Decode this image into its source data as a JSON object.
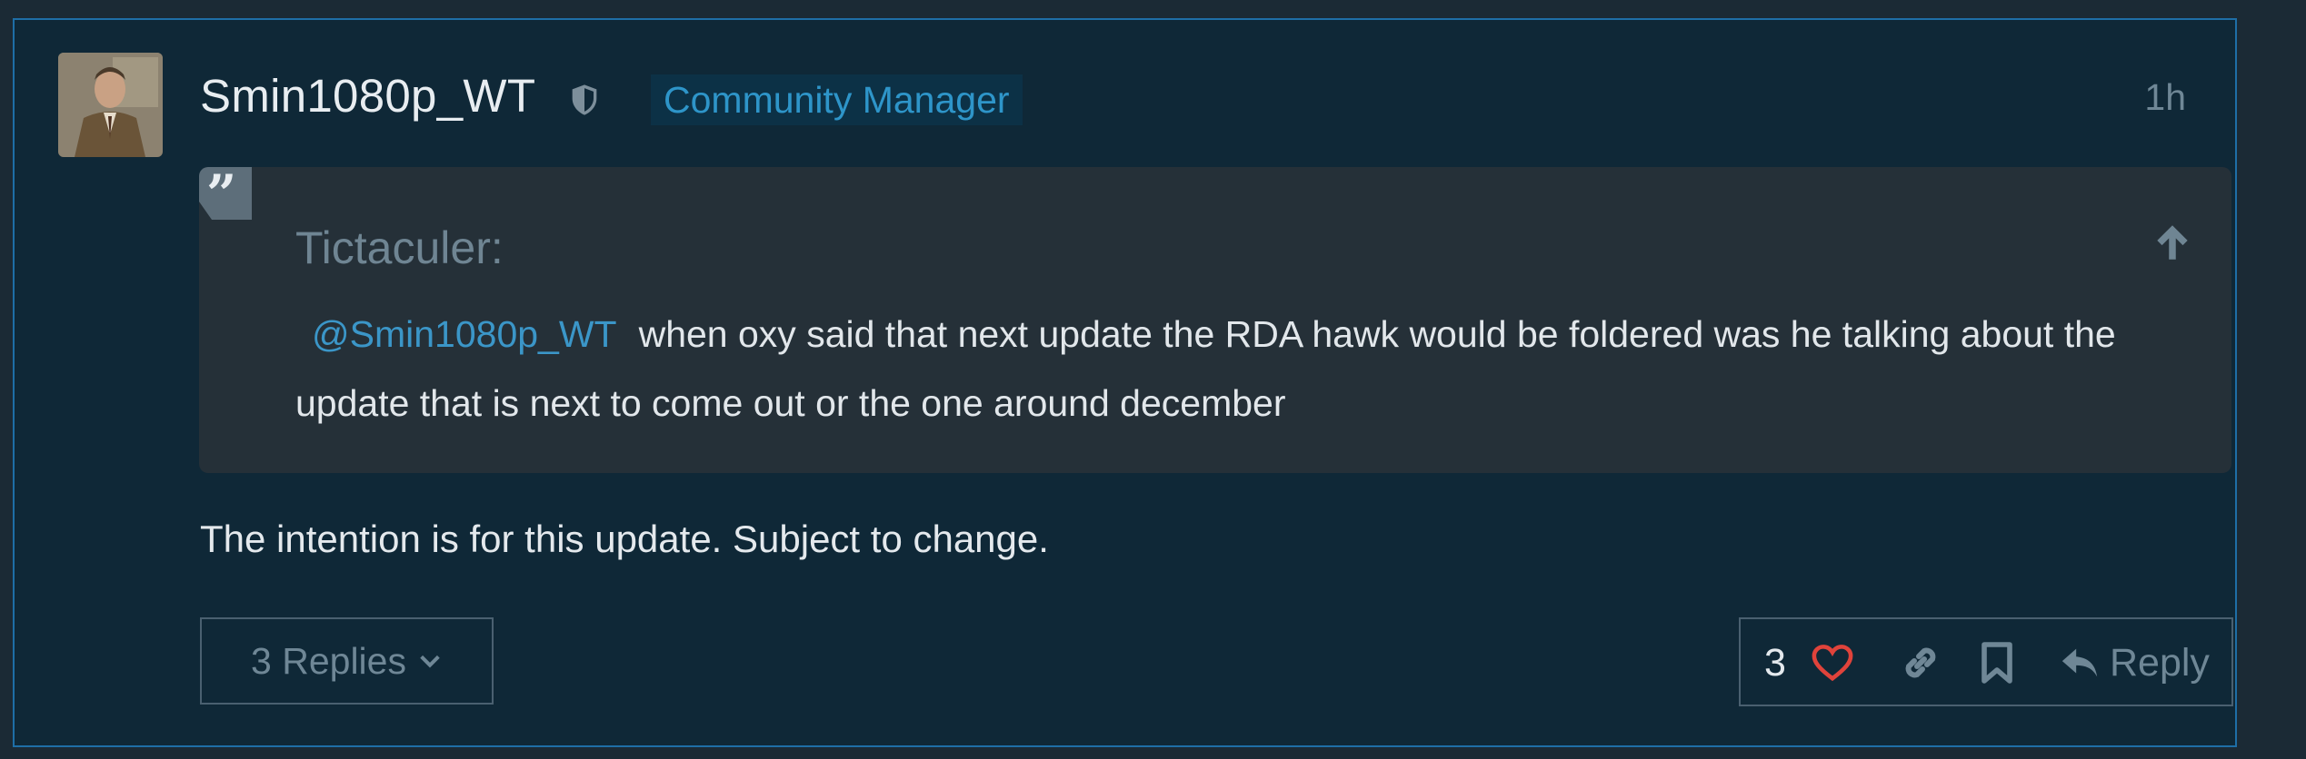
{
  "post": {
    "username": "Smin1080p_WT",
    "user_title": "Community Manager",
    "timestamp": "1h",
    "quote": {
      "author": "Tictaculer:",
      "mention": "@Smin1080p_WT",
      "text": "when oxy said that next update the RDA hawk would be foldered was he talking about the update that is next to come out or the one around december"
    },
    "body": "The intention is for this update. Subject to change.",
    "replies_label": "3 Replies",
    "like_count": "3",
    "reply_label": "Reply"
  },
  "colors": {
    "accent": "#2e95c9",
    "like": "#e0433b",
    "border": "#1e6ea6"
  }
}
